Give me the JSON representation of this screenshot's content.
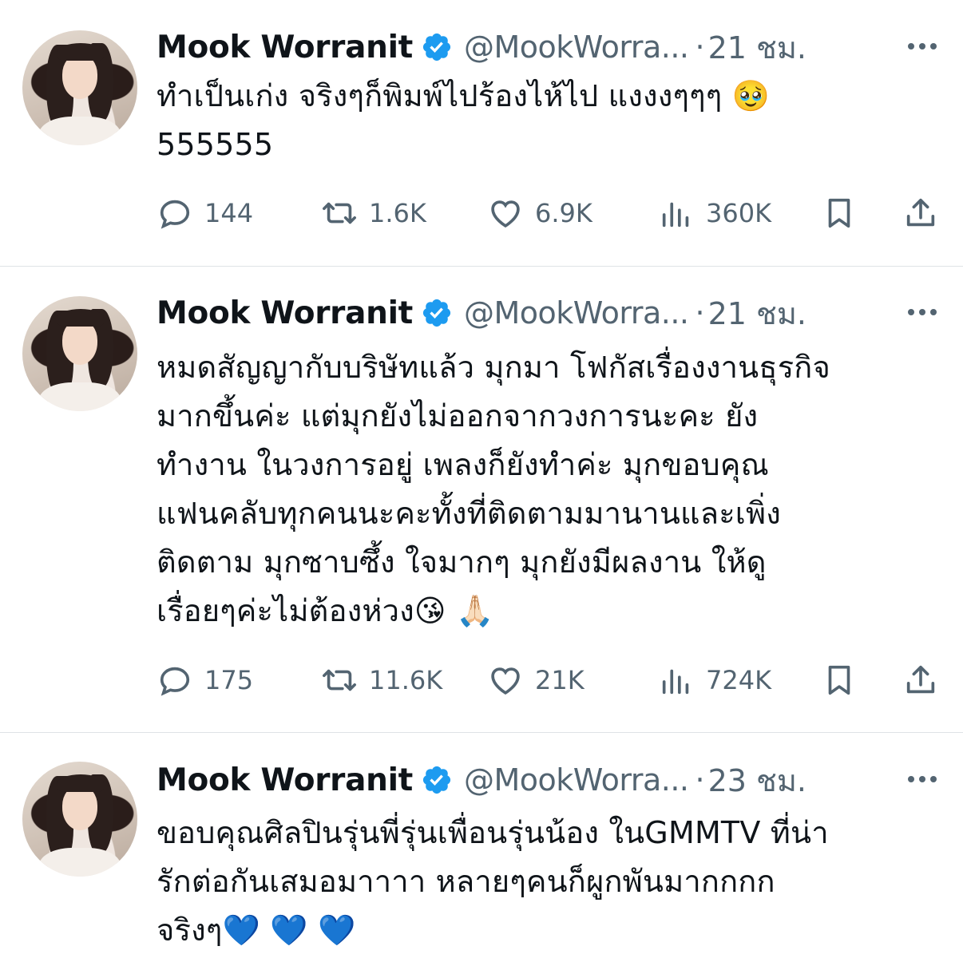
{
  "tweets": [
    {
      "name": "Mook Worranit",
      "handle": "@MookWorra...",
      "dot": "·",
      "time": "21 ชม.",
      "text": "ทำเป็นเก่ง จริงๆก็พิมพ์ไปร้องไห้ไป แงงงๆๆๆ 🥹\n555555",
      "replies": "144",
      "retweets": "1.6K",
      "likes": "6.9K",
      "views": "360K"
    },
    {
      "name": "Mook Worranit",
      "handle": "@MookWorra...",
      "dot": "·",
      "time": "21 ชม.",
      "text": "หมดสัญญากับบริษัทแล้ว มุกมา โฟกัสเรื่องงานธุรกิจ\nมากขึ้นค่ะ แต่มุกยังไม่ออกจากวงการนะคะ ยัง\nทำงาน ในวงการอยู่  เพลงก็ยังทำค่ะ มุกขอบคุณ\nแฟนคลับทุกคนนะคะทั้งที่ติดตามมานานและเพิ่ง\nติดตาม มุกซาบซึ้ง ใจมากๆ มุกยังมีผลงาน ให้ดู\nเรื่อยๆค่ะไม่ต้องห่วง😘 🙏🏻",
      "replies": "175",
      "retweets": "11.6K",
      "likes": "21K",
      "views": "724K"
    },
    {
      "name": "Mook Worranit",
      "handle": "@MookWorra...",
      "dot": "·",
      "time": "23 ชม.",
      "text": "ขอบคุณศิลปินรุ่นพี่รุ่นเพื่อนรุ่นน้อง ในGMMTV ที่น่า\nรักต่อกันเสมอมาาาา หลายๆคนก็ผูกพันมากกกก\nจริงๆ💙 💙 💙"
    }
  ],
  "icons": {
    "reply": "speech-bubble",
    "retweet": "retweet-arrows",
    "like": "heart-outline",
    "views": "bar-chart",
    "bookmark": "bookmark-outline",
    "share": "share-upload",
    "verified": "blue-check-badge",
    "more": "three-dots"
  },
  "colors": {
    "verified": "#1d9bf0",
    "secondary_text": "#536471",
    "divider": "#dfe3e6"
  }
}
